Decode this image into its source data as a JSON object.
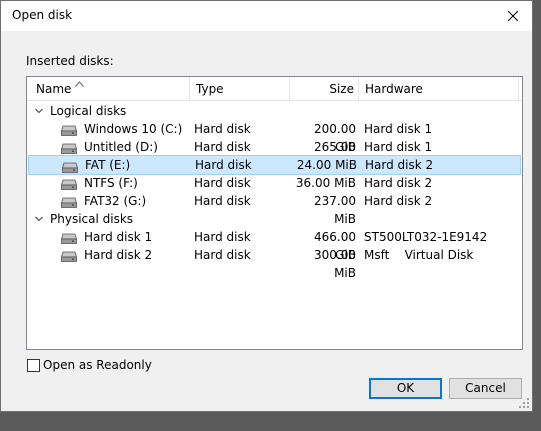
{
  "window": {
    "title": "Open disk"
  },
  "labels": {
    "inserted_disks": "Inserted disks:"
  },
  "table": {
    "columns": [
      "Name",
      "Type",
      "Size",
      "Hardware"
    ],
    "sort_column": "Name",
    "groups": [
      {
        "label": "Logical disks",
        "rows": [
          {
            "name": "Windows 10 (C:)",
            "type": "Hard disk",
            "size": "200.00 GiB",
            "hardware": "Hard disk 1",
            "selected": false
          },
          {
            "name": "Untitled (D:)",
            "type": "Hard disk",
            "size": "265.00 GiB",
            "hardware": "Hard disk 1",
            "selected": false
          },
          {
            "name": "FAT (E:)",
            "type": "Hard disk",
            "size": "24.00 MiB",
            "hardware": "Hard disk 2",
            "selected": true
          },
          {
            "name": "NTFS (F:)",
            "type": "Hard disk",
            "size": "36.00 MiB",
            "hardware": "Hard disk 2",
            "selected": false
          },
          {
            "name": "FAT32 (G:)",
            "type": "Hard disk",
            "size": "237.00 MiB",
            "hardware": "Hard disk 2",
            "selected": false
          }
        ]
      },
      {
        "label": "Physical disks",
        "rows": [
          {
            "name": "Hard disk 1",
            "type": "Hard disk",
            "size": "466.00 GiB",
            "hardware": "ST500LT032-1E9142",
            "selected": false
          },
          {
            "name": "Hard disk 2",
            "type": "Hard disk",
            "size": "300.00 MiB",
            "hardware": "Msft    Virtual Disk",
            "selected": false
          }
        ]
      }
    ]
  },
  "options": {
    "readonly_label": "Open as Readonly",
    "readonly_checked": false
  },
  "buttons": {
    "ok": "OK",
    "cancel": "Cancel"
  },
  "icons": {
    "close": "close-icon",
    "sort": "sort-ascending-icon",
    "expander": "chevron-down-icon",
    "disk": "hard-disk-icon",
    "grip": "resize-grip-icon"
  },
  "colors": {
    "selection": "#cce8ff",
    "selection_border": "#99d1ff",
    "default_button_border": "#0078d7"
  }
}
